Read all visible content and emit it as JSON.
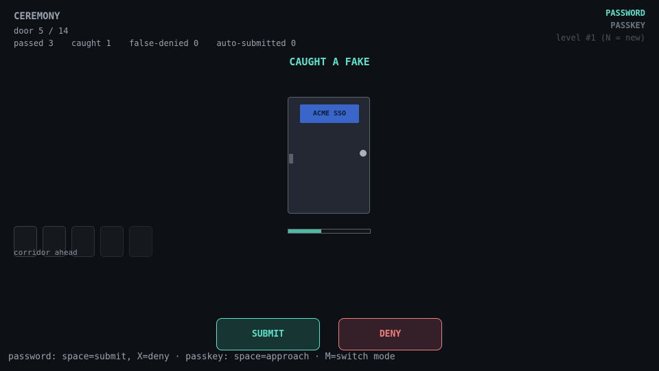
{
  "game": {
    "title": "CEREMONY",
    "door_counter": "door 5 / 14",
    "door_index": 5,
    "door_total": 14
  },
  "stats": {
    "passed": "passed 3",
    "caught": "caught 1",
    "false_denied": "false-denied 0",
    "auto_submitted": "auto-submitted 0"
  },
  "modes": {
    "password": "PASSWORD",
    "passkey": "PASSKEY",
    "active": "PASSWORD"
  },
  "level": "level #1 (N = new)",
  "status_message": "CAUGHT A FAKE",
  "door": {
    "sign": "ACME SSO",
    "sign_color": "#3a66c9",
    "timer_fraction": 0.4
  },
  "corridor": {
    "label": "corridor ahead",
    "doors": [
      {
        "border": "#3a4048"
      },
      {
        "border": "#343a42"
      },
      {
        "border": "#2e343c"
      },
      {
        "border": "#282d34"
      },
      {
        "border": "#22272d"
      }
    ]
  },
  "actions": {
    "submit_label": "SUBMIT",
    "deny_label": "DENY"
  },
  "help": "password: space=submit, X=deny · passkey: space=approach · M=switch mode",
  "colors": {
    "background": "#0d1014",
    "accent": "#5ee0c9",
    "danger": "#ee7f7b",
    "muted": "#6a7480"
  }
}
